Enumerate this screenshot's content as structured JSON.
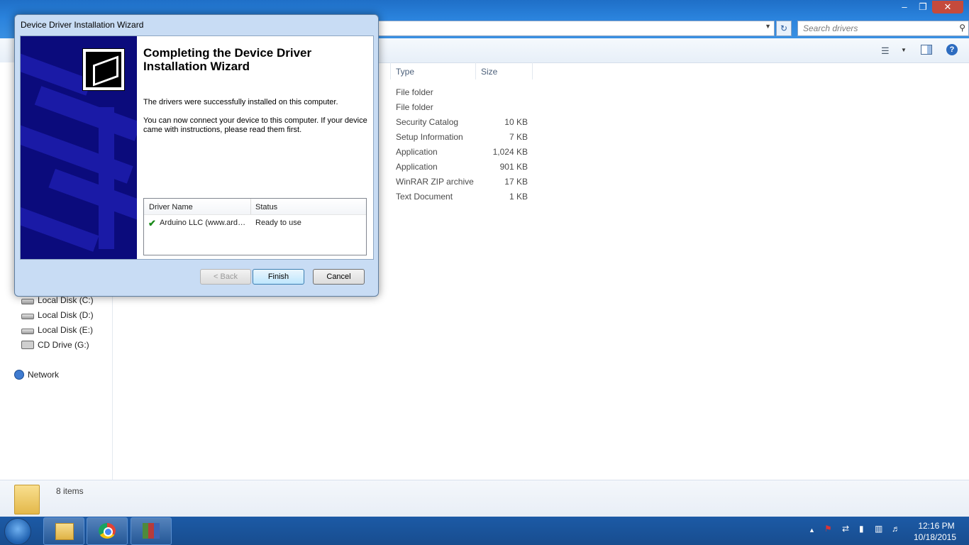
{
  "explorer": {
    "search_placeholder": "Search drivers",
    "columns": {
      "type": "Type",
      "size": "Size"
    },
    "rows": [
      {
        "type": "File folder",
        "size": ""
      },
      {
        "type": "File folder",
        "size": ""
      },
      {
        "type": "Security Catalog",
        "size": "10 KB"
      },
      {
        "type": "Setup Information",
        "size": "7 KB"
      },
      {
        "type": "Application",
        "size": "1,024 KB"
      },
      {
        "type": "Application",
        "size": "901 KB"
      },
      {
        "type": "WinRAR ZIP archive",
        "size": "17 KB"
      },
      {
        "type": "Text Document",
        "size": "1 KB"
      }
    ],
    "nav": {
      "local_c": "Local Disk (C:)",
      "local_d": "Local Disk (D:)",
      "local_e": "Local Disk (E:)",
      "cd_drive": "CD Drive (G:)",
      "network": "Network"
    },
    "status": {
      "items": "8 items"
    }
  },
  "dialog": {
    "title": "Device Driver Installation Wizard",
    "heading": "Completing the Device Driver Installation Wizard",
    "text1": "The drivers were successfully installed on this computer.",
    "text2": "You can now connect your device to this computer. If your device came with instructions, please read them first.",
    "table": {
      "col_name": "Driver Name",
      "col_status": "Status",
      "row": {
        "name": "Arduino LLC (www.arduino.cc) Ports",
        "status": "Ready to use"
      }
    },
    "buttons": {
      "back": "< Back",
      "finish": "Finish",
      "cancel": "Cancel"
    }
  },
  "taskbar": {
    "time": "12:16 PM",
    "date": "10/18/2015"
  }
}
